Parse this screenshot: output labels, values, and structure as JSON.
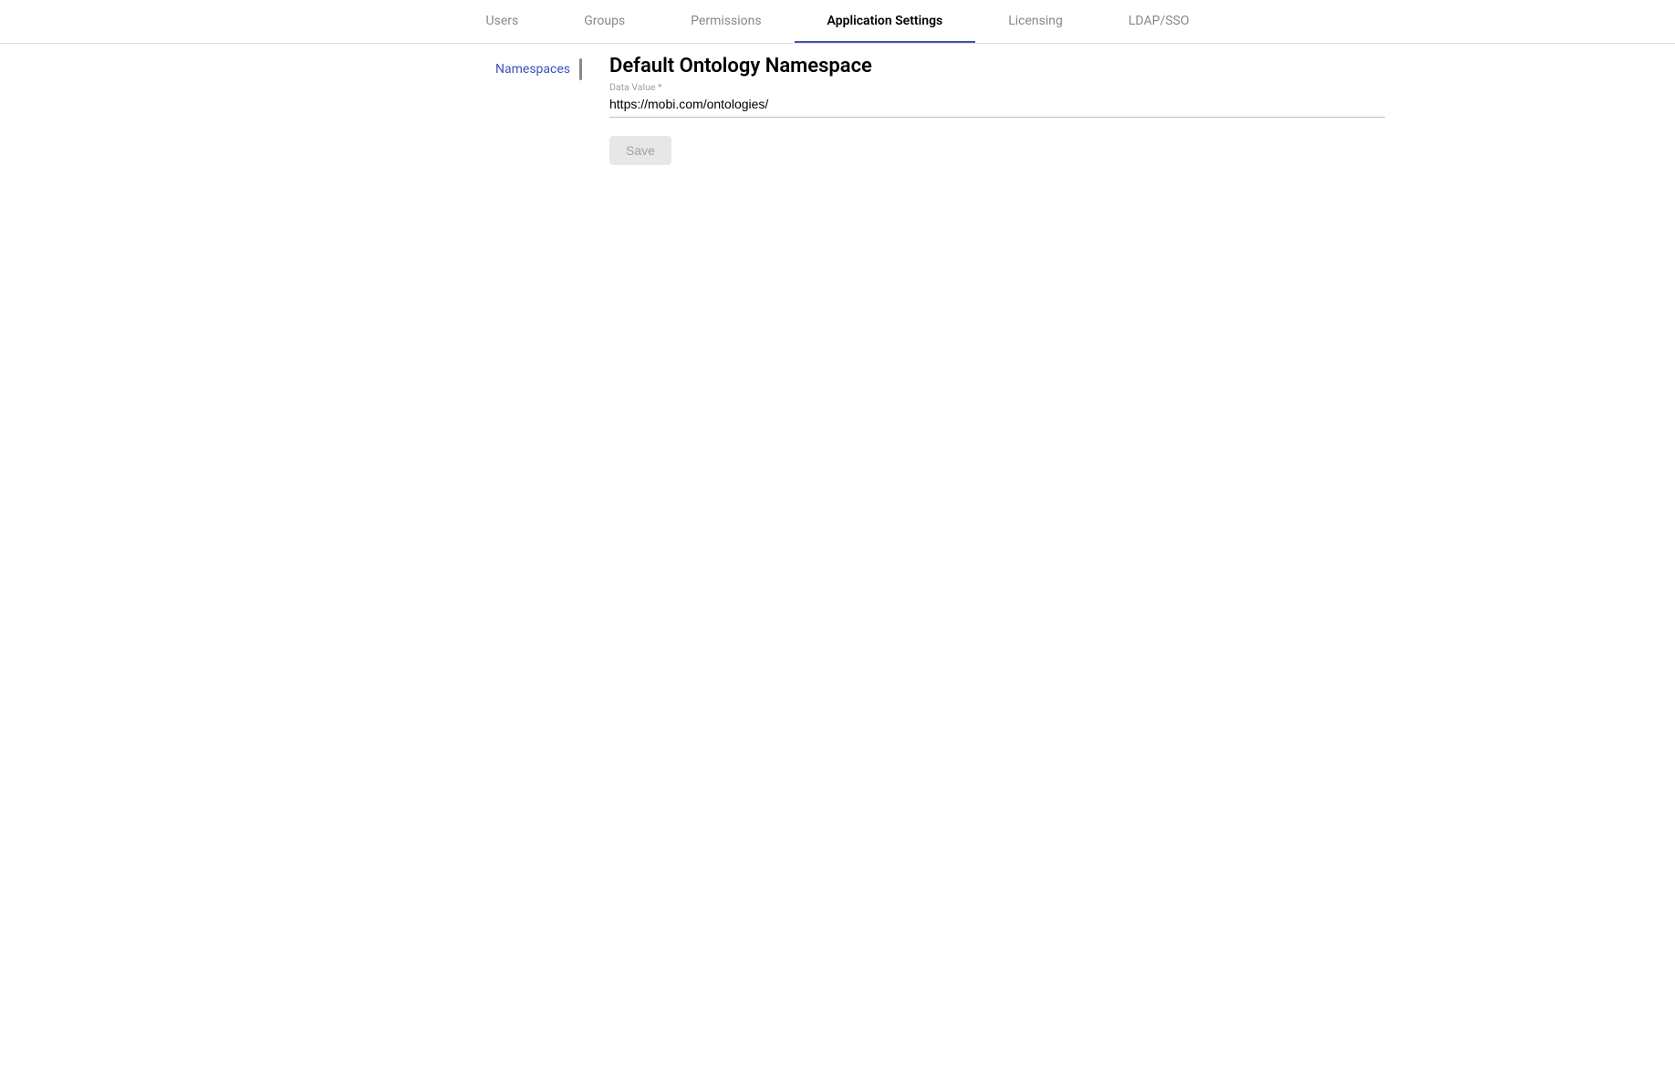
{
  "tabs": [
    {
      "label": "Users",
      "active": false
    },
    {
      "label": "Groups",
      "active": false
    },
    {
      "label": "Permissions",
      "active": false
    },
    {
      "label": "Application Settings",
      "active": true
    },
    {
      "label": "Licensing",
      "active": false
    },
    {
      "label": "LDAP/SSO",
      "active": false
    }
  ],
  "sidebar": {
    "items": [
      {
        "label": "Namespaces",
        "active": true
      }
    ]
  },
  "main": {
    "section_title": "Default Ontology Namespace",
    "field_label": "Data Value *",
    "field_value": "https://mobi.com/ontologies/",
    "save_label": "Save"
  }
}
